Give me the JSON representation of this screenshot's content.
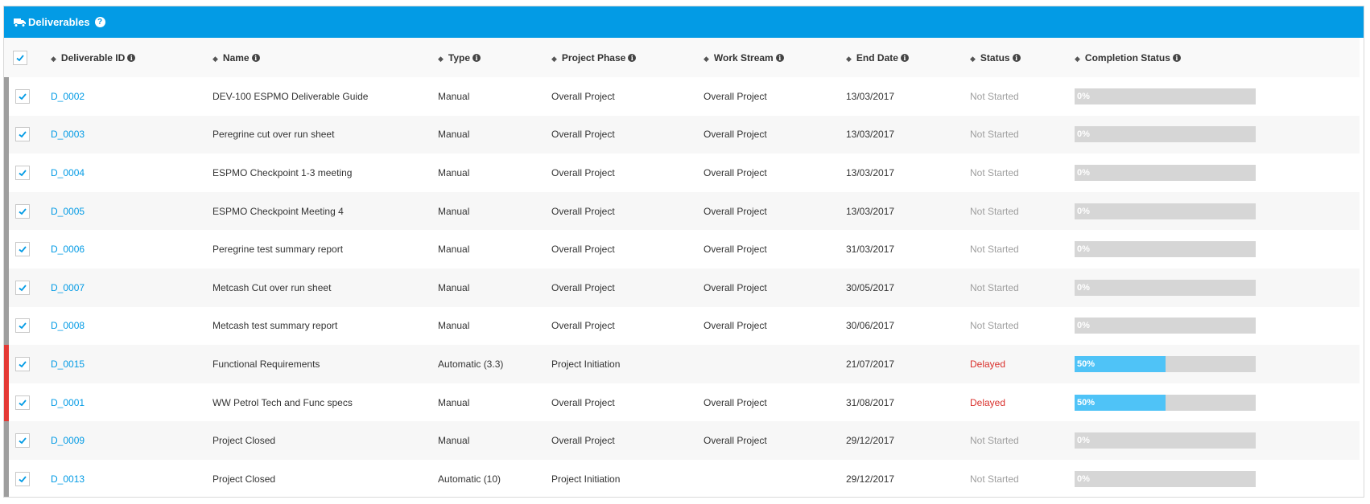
{
  "panel": {
    "title": "Deliverables",
    "title_icon": "truck-icon",
    "help_icon": "question-circle-icon",
    "help_glyph": "?"
  },
  "colors": {
    "header": "#039be5",
    "link": "#039be5",
    "delayed": "#d9302c",
    "not_started": "#9e9e9e",
    "bar_bg": "#d6d6d6",
    "bar_fill": "#4fc3f7",
    "mark_gray": "#9e9e9e",
    "mark_red": "#e53935"
  },
  "table": {
    "columns": [
      {
        "label": "Deliverable ID"
      },
      {
        "label": "Name"
      },
      {
        "label": "Type"
      },
      {
        "label": "Project Phase"
      },
      {
        "label": "Work Stream"
      },
      {
        "label": "End Date"
      },
      {
        "label": "Status"
      },
      {
        "label": "Completion Status"
      }
    ],
    "rows": [
      {
        "id": "D_0002",
        "name": "DEV-100 ESPMO Deliverable Guide",
        "type": "Manual",
        "phase": "Overall Project",
        "stream": "Overall Project",
        "end": "13/03/2017",
        "status": "Not Started",
        "delayed": false,
        "percent": 0,
        "percent_label": "0%",
        "selected": true
      },
      {
        "id": "D_0003",
        "name": "Peregrine cut over run sheet",
        "type": "Manual",
        "phase": "Overall Project",
        "stream": "Overall Project",
        "end": "13/03/2017",
        "status": "Not Started",
        "delayed": false,
        "percent": 0,
        "percent_label": "0%",
        "selected": true
      },
      {
        "id": "D_0004",
        "name": "ESPMO Checkpoint 1-3 meeting",
        "type": "Manual",
        "phase": "Overall Project",
        "stream": "Overall Project",
        "end": "13/03/2017",
        "status": "Not Started",
        "delayed": false,
        "percent": 0,
        "percent_label": "0%",
        "selected": true
      },
      {
        "id": "D_0005",
        "name": "ESPMO Checkpoint Meeting 4",
        "type": "Manual",
        "phase": "Overall Project",
        "stream": "Overall Project",
        "end": "13/03/2017",
        "status": "Not Started",
        "delayed": false,
        "percent": 0,
        "percent_label": "0%",
        "selected": true
      },
      {
        "id": "D_0006",
        "name": "Peregrine test summary report",
        "type": "Manual",
        "phase": "Overall Project",
        "stream": "Overall Project",
        "end": "31/03/2017",
        "status": "Not Started",
        "delayed": false,
        "percent": 0,
        "percent_label": "0%",
        "selected": true
      },
      {
        "id": "D_0007",
        "name": "Metcash Cut over run sheet",
        "type": "Manual",
        "phase": "Overall Project",
        "stream": "Overall Project",
        "end": "30/05/2017",
        "status": "Not Started",
        "delayed": false,
        "percent": 0,
        "percent_label": "0%",
        "selected": true
      },
      {
        "id": "D_0008",
        "name": "Metcash test summary report",
        "type": "Manual",
        "phase": "Overall Project",
        "stream": "Overall Project",
        "end": "30/06/2017",
        "status": "Not Started",
        "delayed": false,
        "percent": 0,
        "percent_label": "0%",
        "selected": true
      },
      {
        "id": "D_0015",
        "name": "Functional Requirements",
        "type": "Automatic (3.3)",
        "phase": "Project Initiation",
        "stream": "",
        "end": "21/07/2017",
        "status": "Delayed",
        "delayed": true,
        "percent": 50,
        "percent_label": "50%",
        "selected": true
      },
      {
        "id": "D_0001",
        "name": "WW Petrol Tech and Func specs",
        "type": "Manual",
        "phase": "Overall Project",
        "stream": "Overall Project",
        "end": "31/08/2017",
        "status": "Delayed",
        "delayed": true,
        "percent": 50,
        "percent_label": "50%",
        "selected": true
      },
      {
        "id": "D_0009",
        "name": "Project Closed",
        "type": "Manual",
        "phase": "Overall Project",
        "stream": "Overall Project",
        "end": "29/12/2017",
        "status": "Not Started",
        "delayed": false,
        "percent": 0,
        "percent_label": "0%",
        "selected": true
      },
      {
        "id": "D_0013",
        "name": "Project Closed",
        "type": "Automatic (10)",
        "phase": "Project Initiation",
        "stream": "",
        "end": "29/12/2017",
        "status": "Not Started",
        "delayed": false,
        "percent": 0,
        "percent_label": "0%",
        "selected": true
      }
    ]
  }
}
